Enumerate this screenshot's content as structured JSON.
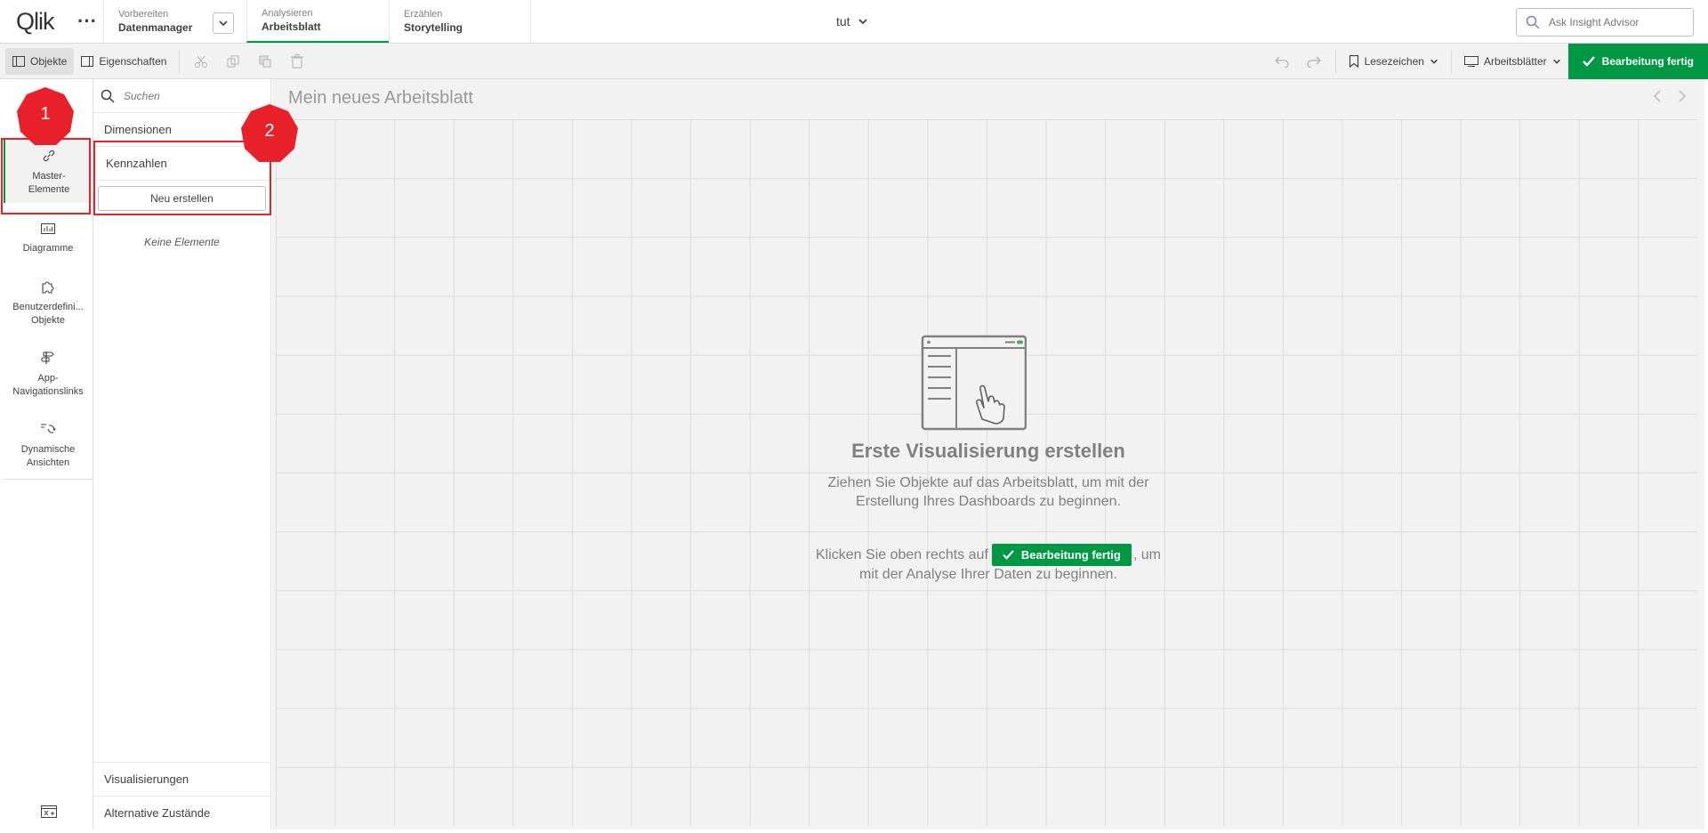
{
  "app": {
    "logo": "Qlik",
    "more": "···",
    "title": "tut"
  },
  "nav": {
    "prepare": {
      "sub": "Vorbereiten",
      "main": "Datenmanager"
    },
    "analyze": {
      "sub": "Analysieren",
      "main": "Arbeitsblatt"
    },
    "narrate": {
      "sub": "Erzählen",
      "main": "Storytelling"
    }
  },
  "insight": {
    "placeholder": "Ask Insight Advisor"
  },
  "toolbar": {
    "objects": "Objekte",
    "properties": "Eigenschaften",
    "bookmarks": "Lesezeichen",
    "sheets": "Arbeitsblätter",
    "done": "Bearbeitung fertig"
  },
  "rail": {
    "items": [
      {
        "label": "Master-\nElemente"
      },
      {
        "label": "Diagramme"
      },
      {
        "label": "Benutzerdefini...\nObjekte"
      },
      {
        "label": "App-\nNavigationslinks"
      },
      {
        "label": "Dynamische\nAnsichten"
      }
    ]
  },
  "assets": {
    "search_placeholder": "Suchen",
    "dimensions": "Dimensionen",
    "measures": "Kennzahlen",
    "create_new": "Neu erstellen",
    "empty": "Keine Elemente",
    "visualizations": "Visualisierungen",
    "alt_states": "Alternative Zustände"
  },
  "canvas": {
    "sheet_title": "Mein neues Arbeitsblatt",
    "hint_title": "Erste Visualisierung erstellen",
    "hint_line1": "Ziehen Sie Objekte auf das Arbeitsblatt, um mit der",
    "hint_line2": "Erstellung Ihres Dashboards zu beginnen.",
    "hint_click_prefix": "Klicken Sie oben rechts auf",
    "hint_done": "Bearbeitung fertig",
    "hint_click_suffix": ", um",
    "hint_line4": "mit der Analyse Ihrer Daten zu beginnen."
  },
  "annotations": {
    "badge1": "1",
    "badge2": "2",
    "color": "#e8202a"
  },
  "colors": {
    "accent": "#009845"
  }
}
